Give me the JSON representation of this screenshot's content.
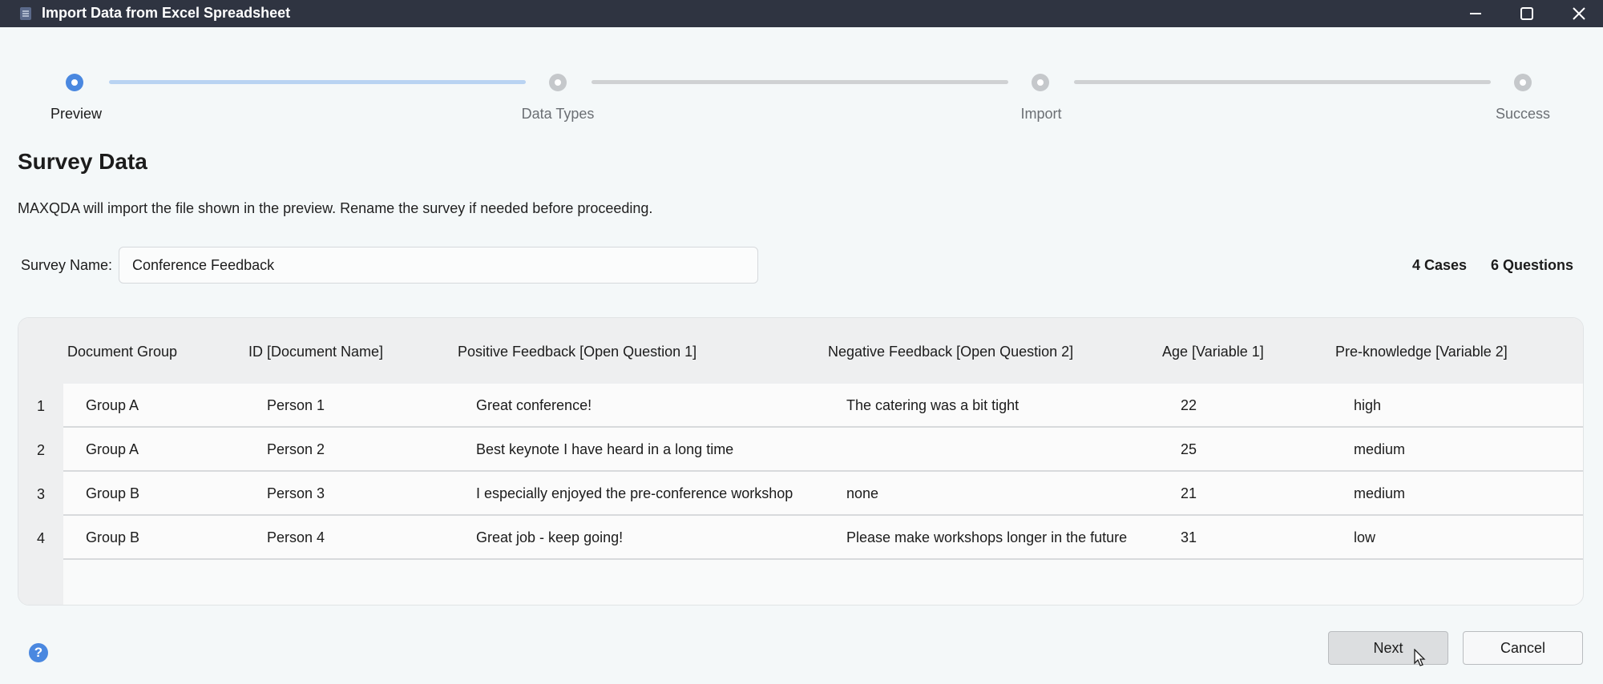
{
  "window": {
    "title": "Import Data from Excel Spreadsheet",
    "app_icon": "spreadsheet-icon"
  },
  "stepper": {
    "steps": [
      {
        "label": "Preview",
        "state": "active"
      },
      {
        "label": "Data Types",
        "state": "inactive"
      },
      {
        "label": "Import",
        "state": "inactive"
      },
      {
        "label": "Success",
        "state": "inactive"
      }
    ]
  },
  "page": {
    "title": "Survey Data",
    "description": "MAXQDA will import the file shown in the preview. Rename the survey if needed before proceeding."
  },
  "survey": {
    "name_label": "Survey Name:",
    "name_value": "Conference Feedback",
    "cases": "4 Cases",
    "questions": "6 Questions"
  },
  "table": {
    "columns": [
      "Document Group",
      "ID [Document Name]",
      "Positive Feedback [Open Question 1]",
      "Negative Feedback [Open Question 2]",
      "Age [Variable 1]",
      "Pre-knowledge [Variable 2]"
    ],
    "rows": [
      {
        "num": "1",
        "cells": [
          "Group A",
          "Person 1",
          "Great conference!",
          "The catering was a bit tight",
          "22",
          "high"
        ]
      },
      {
        "num": "2",
        "cells": [
          "Group A",
          "Person 2",
          "Best keynote I have heard in a long time",
          "",
          "25",
          "medium"
        ]
      },
      {
        "num": "3",
        "cells": [
          "Group B",
          "Person 3",
          "I especially enjoyed the pre-conference workshop",
          "none",
          "21",
          "medium"
        ]
      },
      {
        "num": "4",
        "cells": [
          "Group B",
          "Person 4",
          "Great job - keep going!",
          "Please make workshops longer in the future",
          "31",
          "low"
        ]
      }
    ]
  },
  "footer": {
    "help_icon": "question-icon",
    "next_label": "Next",
    "cancel_label": "Cancel"
  },
  "colors": {
    "accent": "#4a88e0",
    "titlebar": "#2f3441"
  }
}
